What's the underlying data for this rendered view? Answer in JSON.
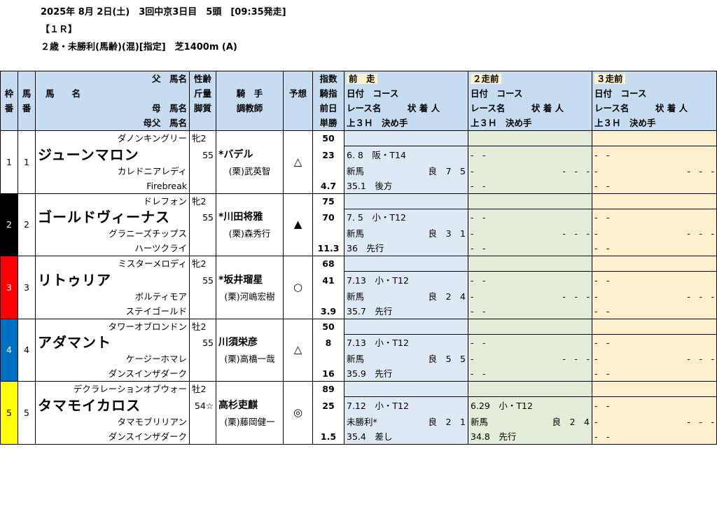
{
  "race": {
    "line1": "2025年 8月 2日(土)　3回中京3日目　5頭　[09:35発走]",
    "line2": "【１Ｒ】",
    "line3": "２歳・未勝利(馬齢)(混)[指定]　芝1400m (A)"
  },
  "header": {
    "waku": "枠番",
    "uma": "馬番",
    "name_label": "馬　　名",
    "sire_label": "父　馬名",
    "dam_label": "母　馬名",
    "bms_label": "母父　馬名",
    "sexage": "性齢",
    "weight": "斤量",
    "style": "脚質",
    "jockey": "騎　手",
    "trainer": "調教師",
    "yoso": "予想",
    "idx1": "指数",
    "idx2": "騎指",
    "idx3": "前日",
    "idx4": "単勝",
    "prev1": "前　走",
    "prev2": "２走前",
    "prev3": "３走前",
    "date_course": "日付　コース",
    "race_result": "レース名　　　状 着 人",
    "last3f": "上３Ｈ　決め手"
  },
  "colors": {
    "frame1": "#ffffff",
    "frame2": "#000000",
    "frame3": "#ff0000",
    "frame4": "#0070c0",
    "frame5": "#ffff00"
  },
  "horses": [
    {
      "frame": "1",
      "num": "1",
      "sire": "ダノンキングリー",
      "name": "ジューンマロン",
      "dam": "カレドニアレディ",
      "bms": "Firebreak",
      "sexage": "牝2",
      "weight": "55",
      "jockey": "*バデル",
      "trainer": "(栗)武英智",
      "mark": "△",
      "idx": "50",
      "jidx": "23",
      "odds": "4.7",
      "p1": {
        "date": "6. 8",
        "course": "阪・T14",
        "race": "新馬",
        "cond": "良",
        "place": "7",
        "pop": "5",
        "l3": "35.1",
        "style": "後方"
      },
      "p2": {
        "date": "-",
        "course": "-",
        "race": "-",
        "cond": "-",
        "place": "-",
        "pop": "-",
        "l3": "-",
        "style": "-"
      },
      "p3": {
        "date": "-",
        "course": "-",
        "race": "-",
        "cond": "-",
        "place": "-",
        "pop": "-",
        "l3": "-",
        "style": "-"
      }
    },
    {
      "frame": "2",
      "num": "2",
      "sire": "ドレフォン",
      "name": "ゴールドヴィーナス",
      "dam": "グラニーズチップス",
      "bms": "ハーツクライ",
      "sexage": "牝2",
      "weight": "55",
      "jockey": "*川田将雅",
      "trainer": "(栗)森秀行",
      "mark": "▲",
      "idx": "75",
      "jidx": "70",
      "odds": "11.3",
      "p1": {
        "date": "7. 5",
        "course": "小・T12",
        "race": "新馬",
        "cond": "良",
        "place": "3",
        "pop": "1",
        "l3": "36",
        "style": "先行"
      },
      "p2": {
        "date": "-",
        "course": "-",
        "race": "-",
        "cond": "-",
        "place": "-",
        "pop": "-",
        "l3": "-",
        "style": "-"
      },
      "p3": {
        "date": "-",
        "course": "-",
        "race": "-",
        "cond": "-",
        "place": "-",
        "pop": "-",
        "l3": "-",
        "style": "-"
      }
    },
    {
      "frame": "3",
      "num": "3",
      "sire": "ミスターメロディ",
      "name": "リトゥリア",
      "dam": "ボルティモア",
      "bms": "ステイゴールド",
      "sexage": "牝2",
      "weight": "55",
      "jockey": "*坂井瑠星",
      "trainer": "(栗)河嶋宏樹",
      "mark": "○",
      "idx": "68",
      "jidx": "41",
      "odds": "3.9",
      "p1": {
        "date": "7.13",
        "course": "小・T12",
        "race": "新馬",
        "cond": "良",
        "place": "2",
        "pop": "4",
        "l3": "35.7",
        "style": "先行"
      },
      "p2": {
        "date": "-",
        "course": "-",
        "race": "-",
        "cond": "-",
        "place": "-",
        "pop": "-",
        "l3": "-",
        "style": "-"
      },
      "p3": {
        "date": "-",
        "course": "-",
        "race": "-",
        "cond": "-",
        "place": "-",
        "pop": "-",
        "l3": "-",
        "style": "-"
      }
    },
    {
      "frame": "4",
      "num": "4",
      "sire": "タワーオブロンドン",
      "name": "アダマント",
      "dam": "ケージーホマレ",
      "bms": "ダンスインザダーク",
      "sexage": "牡2",
      "weight": "55",
      "jockey": "川須栄彦",
      "trainer": "(栗)高橋一哉",
      "mark": "△",
      "idx": "50",
      "jidx": "8",
      "odds": "16",
      "p1": {
        "date": "7.13",
        "course": "小・T12",
        "race": "新馬",
        "cond": "良",
        "place": "5",
        "pop": "5",
        "l3": "35.9",
        "style": "先行"
      },
      "p2": {
        "date": "-",
        "course": "-",
        "race": "-",
        "cond": "-",
        "place": "-",
        "pop": "-",
        "l3": "-",
        "style": "-"
      },
      "p3": {
        "date": "-",
        "course": "-",
        "race": "-",
        "cond": "-",
        "place": "-",
        "pop": "-",
        "l3": "-",
        "style": "-"
      }
    },
    {
      "frame": "5",
      "num": "5",
      "sire": "デクラレーションオブウォー",
      "name": "タマモイカロス",
      "dam": "タマモブリリアン",
      "bms": "ダンスインザダーク",
      "sexage": "牡2",
      "weight": "54☆",
      "jockey": "高杉吏麒",
      "trainer": "(栗)藤岡健一",
      "mark": "◎",
      "idx": "89",
      "jidx": "25",
      "odds": "1.5",
      "p1": {
        "date": "7.12",
        "course": "小・T12",
        "race": "未勝利*",
        "cond": "良",
        "place": "2",
        "pop": "1",
        "l3": "35.4",
        "style": "差し"
      },
      "p2": {
        "date": "6.29",
        "course": "小・T12",
        "race": "新馬",
        "cond": "良",
        "place": "2",
        "pop": "4",
        "l3": "34.8",
        "style": "先行"
      },
      "p3": {
        "date": "-",
        "course": "-",
        "race": "-",
        "cond": "-",
        "place": "-",
        "pop": "-",
        "l3": "-",
        "style": "-"
      }
    }
  ]
}
